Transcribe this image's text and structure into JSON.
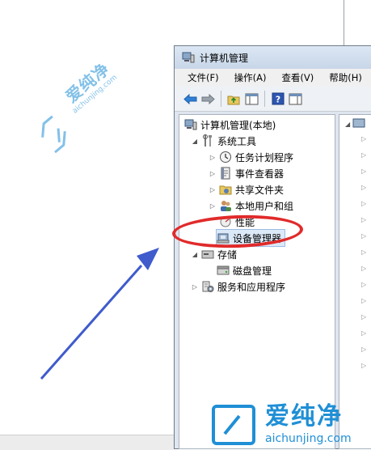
{
  "window": {
    "title": "计算机管理",
    "menu": [
      "文件(F)",
      "操作(A)",
      "查看(V)",
      "帮助(H)"
    ]
  },
  "tree": {
    "root": "计算机管理(本地)",
    "system_tools": "系统工具",
    "task_scheduler": "任务计划程序",
    "event_viewer": "事件查看器",
    "shared_folders": "共享文件夹",
    "local_users": "本地用户和组",
    "performance": "性能",
    "device_manager": "设备管理器",
    "storage": "存储",
    "disk_management": "磁盘管理",
    "services": "服务和应用程序"
  },
  "watermark": {
    "brand": "爱纯净",
    "url": "aichunjing.com"
  },
  "colors": {
    "highlight_ellipse": "#e12a2a",
    "arrow": "#3f5bcc",
    "watermark": "#1f8fd6"
  }
}
